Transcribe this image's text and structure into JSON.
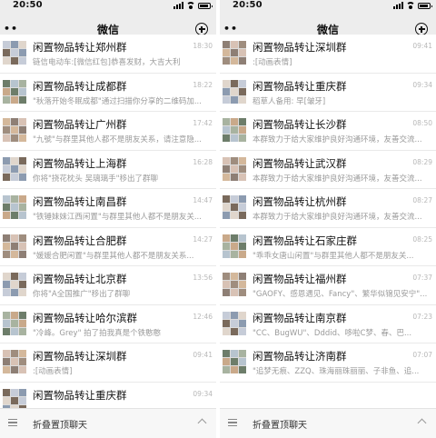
{
  "status": {
    "time": "20:50"
  },
  "header": {
    "title": "微信"
  },
  "bottom_bar": {
    "label": "折叠置顶聊天"
  },
  "left_chats": [
    {
      "name": "闲置物品转让郑州群",
      "preview": "链信电动车:[微信红包]恭喜发财，大吉大利",
      "time": "18:30"
    },
    {
      "name": "闲置物品转让成都群",
      "preview": "\"秋落开始冬眠成都\"通过扫描你分享的二维码加...",
      "time": "18:22"
    },
    {
      "name": "闲置物品转让广州群",
      "preview": "\"九號\"与群里其他人都不是朋友关系，请注意隐...",
      "time": "17:42"
    },
    {
      "name": "闲置物品转让上海群",
      "preview": "你将\"挠花枕头 吴璃璃手\"移出了群聊",
      "time": "16:28"
    },
    {
      "name": "闲置物品转让南昌群",
      "preview": "\"铁锤妹妹江西闲置\"与群里其他人都不是朋友关...",
      "time": "14:47"
    },
    {
      "name": "闲置物品转让合肥群",
      "preview": "\"媛媛合肥闲置\"与群里其他人都不是朋友关系...",
      "time": "14:27"
    },
    {
      "name": "闲置物品转让北京群",
      "preview": "你将\"A全国推广\"移出了群聊",
      "time": "13:56"
    },
    {
      "name": "闲置物品转让哈尔滨群",
      "preview": "\"冷峰。Grey\" 拍了拍我真是个铁憨憨",
      "time": "12:46"
    },
    {
      "name": "闲置物品转让深圳群",
      "preview": ":[动画表情]",
      "time": "09:41"
    },
    {
      "name": "闲置物品转让重庆群",
      "preview": "",
      "time": "09:34"
    }
  ],
  "right_chats": [
    {
      "name": "闲置物品转让深圳群",
      "preview": ":[动画表情]",
      "time": "09:41"
    },
    {
      "name": "闲置物品转让重庆群",
      "preview": "稻草人备用: 早[皱牙]",
      "time": "09:34"
    },
    {
      "name": "闲置物品转让长沙群",
      "preview": "本群致力于给大家维护良好沟通环境，友善交流...",
      "time": "08:50"
    },
    {
      "name": "闲置物品转让武汉群",
      "preview": "本群致力于给大家维护良好沟通环境，友善交流...",
      "time": "08:29"
    },
    {
      "name": "闲置物品转让杭州群",
      "preview": "本群致力于给大家维护良好沟通环境，友善交流...",
      "time": "08:27"
    },
    {
      "name": "闲置物品转让石家庄群",
      "preview": "\"乖乖女唐山闲置\"与群里其他人都不是朋友关...",
      "time": "08:25"
    },
    {
      "name": "闲置物品转让福州群",
      "preview": "\"GAOFY、感恩遇见、Fancy\"、繁华似锦见安宁\"...",
      "time": "07:37"
    },
    {
      "name": "闲置物品转让南京群",
      "preview": "\"CC、BugWU\"、Dddid、哆啦C梦、春、巴...",
      "time": "07:23"
    },
    {
      "name": "闲置物品转让济南群",
      "preview": "\"追梦无痕、ZZQ、珠海丽珠丽丽、子非鱼、追...",
      "time": "07:07"
    }
  ]
}
